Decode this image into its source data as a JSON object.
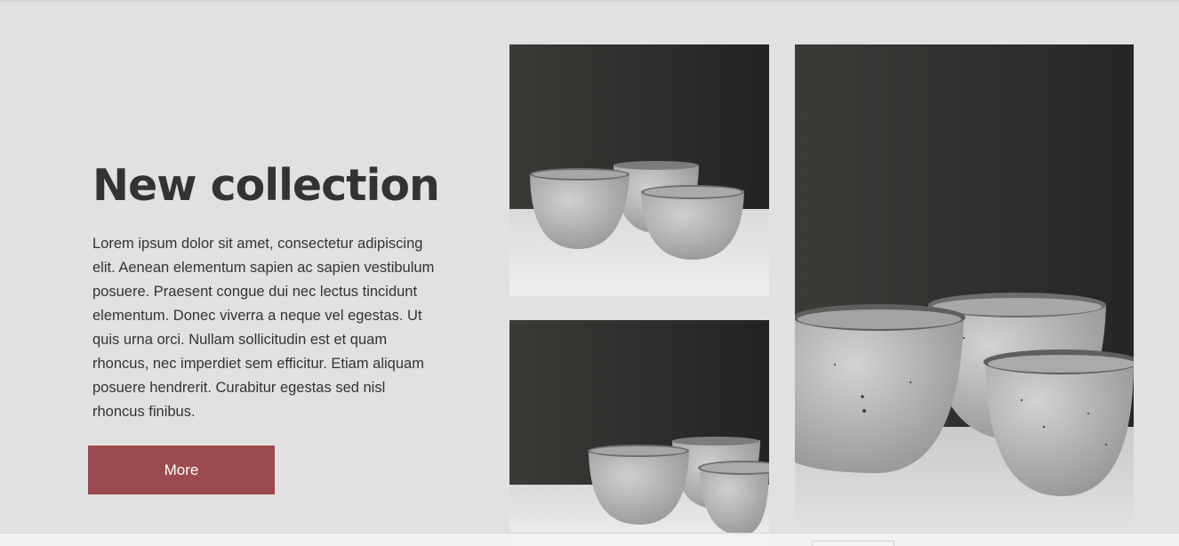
{
  "hero": {
    "title": "New collection",
    "description": "Lorem ipsum dolor sit amet, consectetur adipiscing elit. Aenean elementum sapien ac sapien vestibulum posuere. Praesent congue dui nec lectus tincidunt elementum. Donec viverra a neque vel egestas. Ut quis urna orci. Nullam sollicitudin est et quam rhoncus, nec imperdiet sem efficitur. Etiam aliquam posuere hendrerit. Curabitur egestas sed nisl rhoncus finibus.",
    "button_label": "More"
  },
  "gallery": {
    "images": [
      {
        "subject": "three ceramic bowls on white table, dark background"
      },
      {
        "subject": "three ceramic bowls on white table, dark background"
      },
      {
        "subject": "close-up of three speckled ceramic bowls"
      }
    ]
  },
  "colors": {
    "background": "#e1e1e1",
    "text": "#333333",
    "button": "#9b4b4d",
    "button_text": "#ffffff"
  }
}
